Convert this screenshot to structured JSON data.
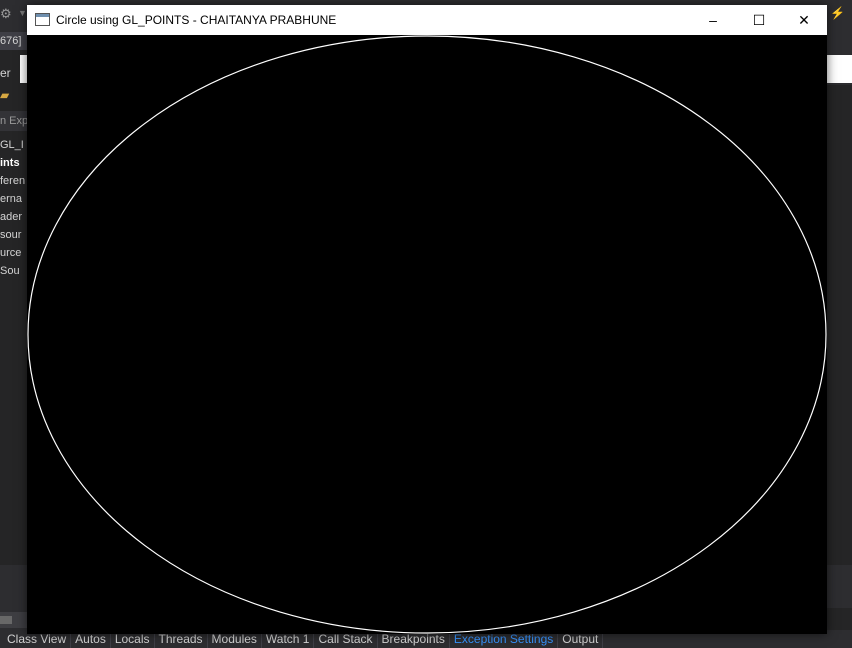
{
  "ide": {
    "process_fragment": "676] ",
    "panel_header_fragment": "er",
    "search_fragment": "n Exp",
    "tree_items": [
      "GL_I",
      "ints",
      "feren",
      "erna",
      "ader",
      "sour",
      "urce",
      "Sou"
    ],
    "tabs": [
      {
        "label": "Class View",
        "active": false
      },
      {
        "label": "Autos",
        "active": false
      },
      {
        "label": "Locals",
        "active": false
      },
      {
        "label": "Threads",
        "active": false
      },
      {
        "label": "Modules",
        "active": false
      },
      {
        "label": "Watch 1",
        "active": false
      },
      {
        "label": "Call Stack",
        "active": false
      },
      {
        "label": "Breakpoints",
        "active": false
      },
      {
        "label": "Exception Settings",
        "active": true
      },
      {
        "label": "Output",
        "active": false
      }
    ],
    "colors": {
      "background": "#2d2d30",
      "active_tab": "#3794ff"
    }
  },
  "window": {
    "title": "Circle using GL_POINTS - CHAITANYA PRABHUNE",
    "controls": {
      "minimize": "–",
      "maximize": "☐",
      "close": "✕"
    },
    "icon": "app-window-icon"
  },
  "canvas": {
    "background": "#000000",
    "stroke": "#ffffff",
    "shape": "circle"
  }
}
